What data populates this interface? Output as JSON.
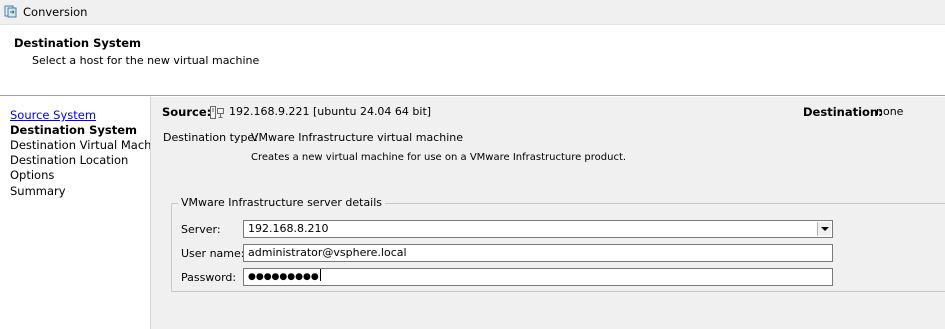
{
  "window": {
    "title": "Conversion"
  },
  "header": {
    "title": "Destination System",
    "subtitle": "Select a host for the new virtual machine"
  },
  "nav": {
    "items": [
      {
        "label": "Source System",
        "state": "link"
      },
      {
        "label": "Destination System",
        "state": "current"
      },
      {
        "label": "Destination Virtual Machine",
        "state": "normal"
      },
      {
        "label": "Destination Location",
        "state": "normal"
      },
      {
        "label": "Options",
        "state": "normal"
      },
      {
        "label": "Summary",
        "state": "normal"
      }
    ]
  },
  "summary": {
    "source_label": "Source:",
    "source_icon": "computer-icon",
    "source_value": "192.168.9.221 [ubuntu 24.04 64 bit]",
    "destination_label": "Destination:",
    "destination_value": "none"
  },
  "destination_type": {
    "label": "Destination type:",
    "value": "VMware Infrastructure virtual machine",
    "description": "Creates a new virtual machine for use on a VMware Infrastructure product."
  },
  "server_details": {
    "legend": "VMware Infrastructure server details",
    "server_label": "Server:",
    "server_value": "192.168.8.210",
    "username_label": "User name:",
    "username_value": "administrator@vsphere.local",
    "password_label": "Password:",
    "password_mask": "●●●●●●●●●"
  },
  "colors": {
    "link": "#0000ff",
    "content_bg": "#f0f0f0"
  }
}
